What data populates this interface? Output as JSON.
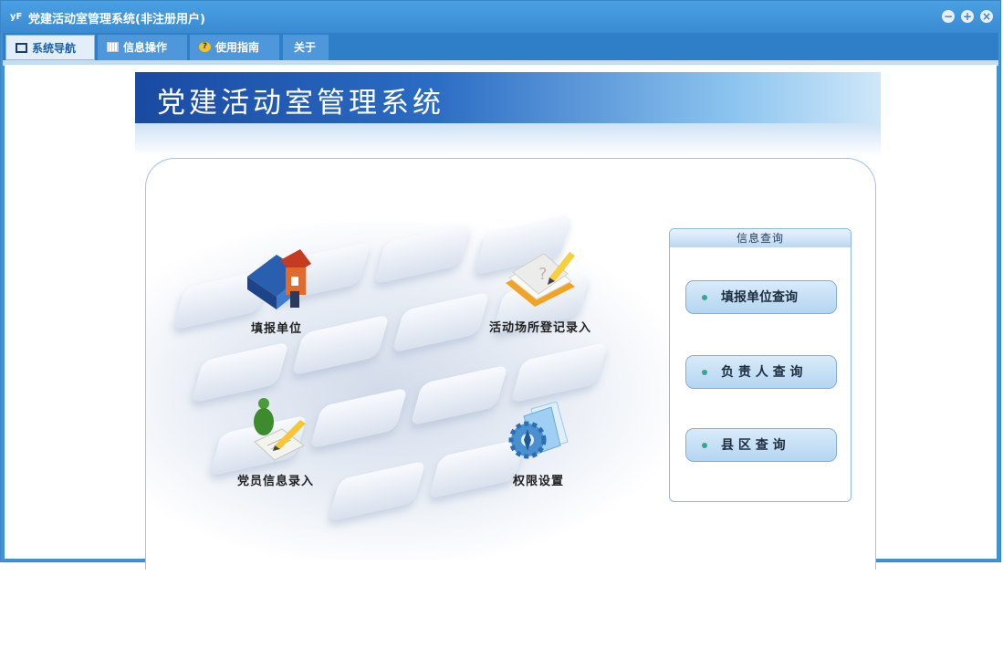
{
  "window": {
    "title": "党建活动室管理系统(非注册用户)",
    "app_icon": "yF"
  },
  "menu": {
    "tabs": [
      {
        "label": "系统导航",
        "icon": "monitor-icon"
      },
      {
        "label": "信息操作",
        "icon": "grid-icon"
      },
      {
        "label": "使用指南",
        "icon": "help-icon"
      },
      {
        "label": "关于"
      }
    ]
  },
  "banner": {
    "title": "党建活动室管理系统"
  },
  "nav_tiles": [
    {
      "label": "填报单位",
      "icon": "house-book-icon"
    },
    {
      "label": "活动场所登记录入",
      "icon": "notebook-pencil-icon"
    },
    {
      "label": "党员信息录入",
      "icon": "person-pencil-icon"
    },
    {
      "label": "权限设置",
      "icon": "gear-folder-icon"
    }
  ],
  "info_query": {
    "title": "信息查询",
    "buttons": [
      {
        "label": "填报单位查询"
      },
      {
        "label": "负 责 人 查 询"
      },
      {
        "label": "县 区 查 询"
      }
    ]
  },
  "colors": {
    "titlebar": "#3a8bd2",
    "menubar": "#2f7fc8",
    "accent": "#1a4aa2"
  }
}
